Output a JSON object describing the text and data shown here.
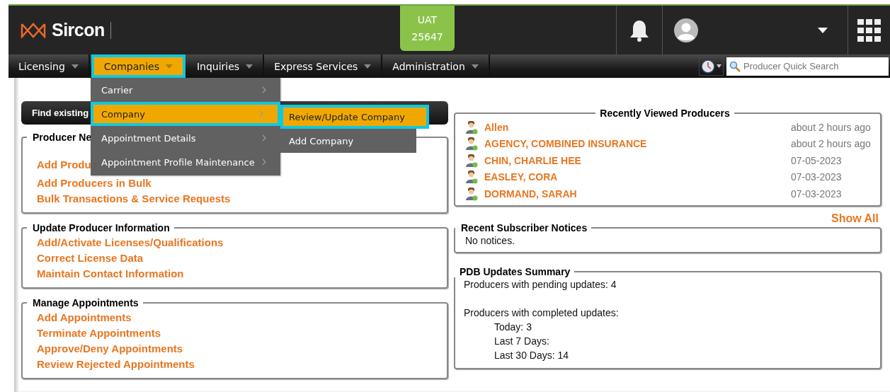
{
  "header": {
    "logo": "Sircon",
    "env_badge": [
      "UAT",
      "25647"
    ]
  },
  "nav": [
    {
      "label": "Licensing",
      "selected": false
    },
    {
      "label": "Companies",
      "selected": true
    },
    {
      "label": "Inquiries",
      "selected": false
    },
    {
      "label": "Express Services",
      "selected": false
    },
    {
      "label": "Administration",
      "selected": false
    }
  ],
  "search": {
    "placeholder": "Producer Quick Search"
  },
  "menu": [
    {
      "label": "Carrier",
      "selected": false
    },
    {
      "label": "Company",
      "selected": true
    },
    {
      "label": "Appointment Details",
      "selected": false
    },
    {
      "label": "Appointment Profile Maintenance",
      "selected": false
    }
  ],
  "submenu": [
    {
      "label": "Review/Update Company",
      "selected": true
    },
    {
      "label": "Add Company",
      "selected": false
    }
  ],
  "find_bar": {
    "label": "Find existing"
  },
  "sections": [
    {
      "title": "Producer Ne",
      "links": [
        "Add Produ",
        "Add Producers in Bulk",
        "Bulk Transactions & Service Requests"
      ]
    },
    {
      "title": "Update Producer Information",
      "links": [
        "Add/Activate Licenses/Qualifications",
        "Correct License Data",
        "Maintain Contact Information"
      ]
    },
    {
      "title": "Manage Appointments",
      "links": [
        "Add Appointments",
        "Terminate Appointments",
        "Approve/Deny Appointments",
        "Review Rejected Appointments"
      ]
    }
  ],
  "recent": {
    "title": "Recently Viewed Producers",
    "rows": [
      {
        "name": "Allen",
        "time": "about 2 hours ago"
      },
      {
        "name": "AGENCY, COMBINED INSURANCE",
        "time": "about 2 hours ago"
      },
      {
        "name": "CHIN, CHARLIE HEE",
        "time": "07-05-2023"
      },
      {
        "name": "EASLEY, CORA",
        "time": "07-03-2023"
      },
      {
        "name": "DORMAND, SARAH",
        "time": "07-03-2023"
      }
    ]
  },
  "show_all": "Show All",
  "notices": {
    "title": "Recent Subscriber Notices",
    "text": "No notices."
  },
  "pdb": {
    "title": "PDB Updates Summary",
    "pending": "Producers with pending updates: 4",
    "completed": "Producers with completed updates:",
    "children": [
      "Today: 3",
      "Last 7 Days:",
      "Last 30 Days: 14"
    ]
  }
}
